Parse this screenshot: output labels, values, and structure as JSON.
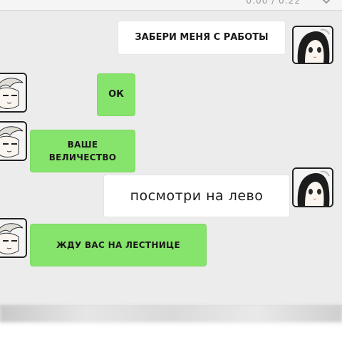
{
  "header": {
    "status_text": "0:00 / 0:22"
  },
  "messages": [
    {
      "side": "right",
      "color": "white",
      "text": "Забери меня с работы",
      "avatar": "girl-avatar-icon"
    },
    {
      "side": "left",
      "color": "green",
      "text": "Ок",
      "avatar": "boy-avatar-icon"
    },
    {
      "side": "left",
      "color": "green",
      "text": "Ваше\nвеличество",
      "avatar": "boy-avatar-icon"
    },
    {
      "side": "right",
      "color": "white",
      "text": "посмотри на лево",
      "avatar": "girl-avatar-icon"
    },
    {
      "side": "left",
      "color": "green",
      "text": "Жду вас на лестнице",
      "avatar": "boy-avatar-icon"
    }
  ],
  "colors": {
    "background": "#ececec",
    "green_bubble": "#86e36b",
    "white_bubble": "#ffffff"
  }
}
